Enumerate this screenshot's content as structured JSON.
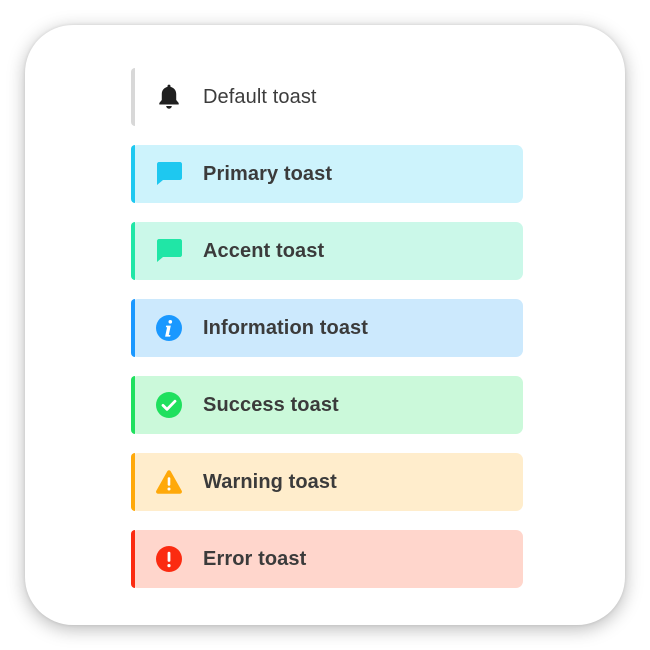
{
  "toasts": [
    {
      "label": "Default toast",
      "icon": "bell-icon",
      "accent": "#d8d8d8",
      "background": "#ffffff",
      "icon_color": "#1f1f1f"
    },
    {
      "label": "Primary toast",
      "icon": "chat-bubble-icon",
      "accent": "#1ec8f0",
      "background": "#cdf3fc",
      "icon_color": "#1ec8f0"
    },
    {
      "label": "Accent toast",
      "icon": "chat-bubble-icon",
      "accent": "#20e6a6",
      "background": "#cbf8e9",
      "icon_color": "#20e6a6"
    },
    {
      "label": "Information toast",
      "icon": "info-icon",
      "accent": "#1a98ff",
      "background": "#cce9fd",
      "icon_color": "#1a98ff"
    },
    {
      "label": "Success toast",
      "icon": "check-circle-icon",
      "accent": "#1fe05e",
      "background": "#cbf9da",
      "icon_color": "#1fe05e"
    },
    {
      "label": "Warning toast",
      "icon": "warning-triangle-icon",
      "accent": "#ffa90a",
      "background": "#ffedcc",
      "icon_color": "#ffa90a"
    },
    {
      "label": "Error toast",
      "icon": "error-circle-icon",
      "accent": "#fb2b11",
      "background": "#ffd6cc",
      "icon_color": "#fb2b11"
    }
  ]
}
